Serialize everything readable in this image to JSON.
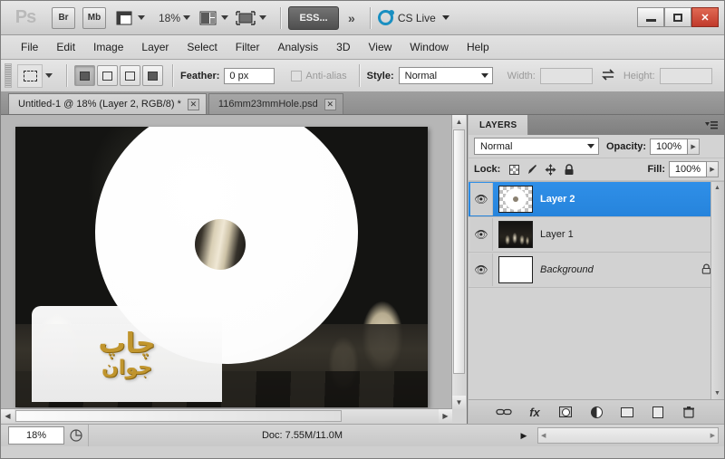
{
  "app": {
    "name": "Adobe Photoshop CS5",
    "logo_text": "Ps"
  },
  "titlebar": {
    "bridge_label": "Br",
    "minibridge_label": "Mb",
    "view_extras_icon": "view-extras-icon",
    "zoom_value": "18%",
    "screen_mode_icon": "screen-mode-icon",
    "arrange_documents_icon": "arrange-documents-icon",
    "workspace_label": "ESS...",
    "more_label": "»",
    "cs_live_label": "CS Live",
    "minimize_label": "minimize",
    "maximize_label": "maximize",
    "close_label": "✕"
  },
  "menubar": {
    "items": [
      {
        "label": "File",
        "mnemonic": "F"
      },
      {
        "label": "Edit",
        "mnemonic": "E"
      },
      {
        "label": "Image",
        "mnemonic": "I"
      },
      {
        "label": "Layer",
        "mnemonic": "L"
      },
      {
        "label": "Select",
        "mnemonic": "S"
      },
      {
        "label": "Filter",
        "mnemonic": "t"
      },
      {
        "label": "Analysis",
        "mnemonic": "A"
      },
      {
        "label": "3D",
        "mnemonic": "D"
      },
      {
        "label": "View",
        "mnemonic": "V"
      },
      {
        "label": "Window",
        "mnemonic": "W"
      },
      {
        "label": "Help",
        "mnemonic": "H"
      }
    ]
  },
  "optionsbar": {
    "tool_icon": "rectangular-marquee-icon",
    "selection_modes": [
      "new-selection",
      "add-to-selection",
      "subtract-from-selection",
      "intersect-with-selection"
    ],
    "feather_label": "Feather:",
    "feather_value": "0 px",
    "antialias_label": "Anti-alias",
    "antialias_checked": false,
    "style_label": "Style:",
    "style_value": "Normal",
    "width_label": "Width:",
    "width_value": "",
    "swap_icon": "swap-width-height-icon",
    "height_label": "Height:",
    "height_value": ""
  },
  "tabs": [
    {
      "title": "Untitled-1 @ 18% (Layer 2, RGB/8) *",
      "active": true,
      "close_label": "✕"
    },
    {
      "title": "116mm23mmHole.psd",
      "active": false,
      "close_label": "✕"
    }
  ],
  "canvas": {
    "watermark_text_top": "چاپ",
    "watermark_text_bottom": "جوان",
    "image_description": "chess-pieces-photo-with-white-disc"
  },
  "layers_panel": {
    "tab_label": "LAYERS",
    "menu_icon": "panel-menu-icon",
    "blend_mode": "Normal",
    "opacity_label": "Opacity:",
    "opacity_value": "100%",
    "lock_label": "Lock:",
    "lock_icons": [
      "lock-transparent-pixels-icon",
      "lock-image-pixels-icon",
      "lock-position-icon",
      "lock-all-icon"
    ],
    "fill_label": "Fill:",
    "fill_value": "100%",
    "layers": [
      {
        "name": "Layer 2",
        "visible": true,
        "selected": true,
        "locked": false,
        "thumb": "disc"
      },
      {
        "name": "Layer 1",
        "visible": true,
        "selected": false,
        "locked": false,
        "thumb": "photo"
      },
      {
        "name": "Background",
        "visible": true,
        "selected": false,
        "locked": true,
        "thumb": "white"
      }
    ],
    "footer_icons": [
      "link-layers-icon",
      "add-layer-style-icon",
      "add-layer-mask-icon",
      "new-adjustment-layer-icon",
      "new-group-icon",
      "new-layer-icon",
      "delete-layer-icon"
    ],
    "fx_label": "fx",
    "link_label": "∞"
  },
  "statusbar": {
    "zoom_value": "18%",
    "preview_icon": "document-preview-icon",
    "doc_info": "Doc: 7.55M/11.0M",
    "play_icon": "status-expand-icon"
  },
  "colors": {
    "accent_selection": "#2684dc",
    "close_button": "#c0392b",
    "cs_live_blue": "#1a8fc1",
    "watermark_gold": "#c79a2e",
    "chrome_light": "#d6d6d6",
    "chrome_dark": "#8d8d8d"
  }
}
